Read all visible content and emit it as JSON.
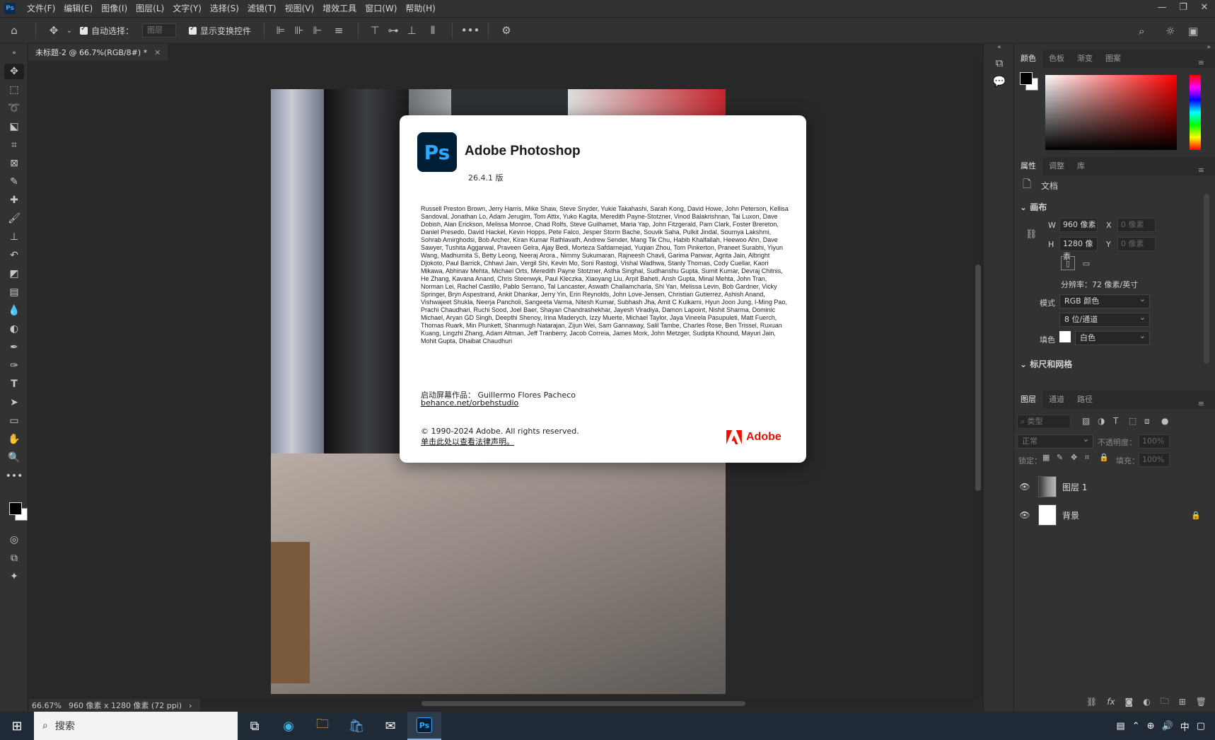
{
  "menubar": {
    "app_icon": "Ps",
    "items": [
      "文件(F)",
      "编辑(E)",
      "图像(I)",
      "图层(L)",
      "文字(Y)",
      "选择(S)",
      "滤镜(T)",
      "视图(V)",
      "增效工具",
      "窗口(W)",
      "帮助(H)"
    ],
    "window_controls": [
      "—",
      "❐",
      "✕"
    ]
  },
  "optionsbar": {
    "auto_select_label": "自动选择：",
    "auto_select_target": "图层",
    "show_transform_label": "显示变换控件"
  },
  "document": {
    "tab_title": "未标题-2 @ 66.7%(RGB/8#) *",
    "zoom": "66.67%",
    "doc_info": "960 像素 x 1280 像素 (72 ppi)"
  },
  "about": {
    "ps_badge": "Ps",
    "app_name": "Adobe Photoshop",
    "version": "26.4.1 版",
    "credits": "Russell Preston Brown, Jerry Harris, Mike Shaw, Steve Snyder, Yukie Takahashi, Sarah Kong, David Howe, John Peterson, Kellisa Sandoval, Jonathan Lo, Adam Jerugim, Tom Attix, Yuko Kagita, Meredith Payne-Stotzner, Vinod Balakrishnan, Tai Luxon, Dave Dobish, Alan Erickson, Melissa Monroe, Chad Rolfs, Steve Guilhamet, Maria Yap, John Fitzgerald, Pam Clark, Foster Brereton, Daniel Presedo, David Hackel, Kevin Hopps, Pete Falco, Jesper Storm Bache, Souvik Saha, Pulkit Jindal, Soumya Lakshmi, Sohrab Amirghodsi, Bob Archer, Kiran Kumar Rathlavath, Andrew Sender, Mang Tik Chu, Habib Khalfallah, Heewoo Ahn, Dave Sawyer, Tushita Aggarwal, Praveen Gelra, Ajay Bedi, Morteza Safdarnejad, Yuqian Zhou, Tom Pinkerton, Praneet Surabhi, Yiyun Wang, Madhumita S, Betty Leong, Neeraj Arora., Nimmy Sukumaran, Rajneesh Chavli, Garima Panwar, Agrita Jain, Albright Djokoto, Paul Barrick, Chhavi Jain, Vergil Shi, Kevin Mo, Soni Rastogi, Vishal Wadhwa, Stanly Thomas, Cody Cuellar, Kaori Mikawa, Abhinav Mehta, Michael Orts, Meredith Payne Stotzner, Astha Singhal, Sudhanshu Gupta, Sumit Kumar, Devraj Chitnis, He Zhang, Kavana Anand, Chris Steenwyk, Paul Kleczka, Xiaoyang Liu, Arpit Baheti, Ansh Gupta, Minal Mehta, John Tran, Norman Lei, Rachel Castillo, Pablo Serrano, Tal Lancaster, Aswath Challamcharla, Shi Yan, Melissa Levin, Bob Gardner, Vicky Springer, Bryn Aspestrand, Ankit Dhankar, Jerry Yin, Erin Reynolds, John Love-Jensen, Christian Gutierrez, Ashish Anand, Vishwajeet Shukla, Neerja Pancholi, Sangeeta Varma, Nitesh Kumar, Subhash Jha, Amit C Kulkarni, Hyun Joon Jung, I-Ming Pao, Prachi Chaudhari, Ruchi Sood, Joel Baer, Shayan Chandrashekhar, Jayesh Viradiya, Damon Lapoint, Nishit Sharma, Dominic Michael, Aryan GD Singh, Deepthi Shenoy, Irina Maderych, Izzy Muerte, Michael Taylor, Jaya Vineela Pasupuleti, Matt Fuerch, Thomas Ruark, Min Plunkett, Shanmugh Natarajan, Zijun Wei, Sam Gannaway, Salil Tambe, Charles Rose, Ben Trissel, Ruxuan Kuang, Lingzhi Zhang, Adam Altman, Jeff Tranberry, Jacob Correia, James Mork, John Metzger, Sudipta Khound, Mayuri Jain, Mohit Gupta, Dhaibat Chaudhuri",
    "splash_label": "启动屏幕作品：",
    "splash_artist": "Guillermo Flores Pacheco",
    "splash_link": "behance.net/orbehstudio",
    "copyright": "© 1990-2024 Adobe. All rights reserved.",
    "legal_link": "单击此处以查看法律声明。",
    "adobe_logo_text": "Adobe"
  },
  "panels": {
    "color_tabs": [
      "颜色",
      "色板",
      "渐变",
      "图案"
    ],
    "props_tabs": [
      "属性",
      "调整",
      "库"
    ],
    "doc_label": "文档",
    "canvas_section": "画布",
    "w_label": "W",
    "w_value": "960 像素",
    "h_label": "H",
    "h_value": "1280 像素",
    "x_label": "X",
    "x_placeholder": "0 像素",
    "y_label": "Y",
    "y_placeholder": "0 像素",
    "resolution": "分辨率：72 像素/英寸",
    "mode_label": "模式",
    "mode_value": "RGB 颜色",
    "depth_value": "8 位/通道",
    "fill_label": "填色",
    "fill_value": "白色",
    "rulers_section": "标尺和网格",
    "layers_tabs": [
      "图层",
      "通道",
      "路径"
    ],
    "filter_placeholder": "类型",
    "blend_mode": "正常",
    "opacity_label": "不透明度：",
    "opacity_value": "100%",
    "lock_label": "锁定：",
    "fill_opacity_label": "填充：",
    "fill_opacity_value": "100%",
    "layers": [
      {
        "name": "图层 1"
      },
      {
        "name": "背景"
      }
    ]
  },
  "taskbar": {
    "search_placeholder": "搜索",
    "tray_ime": "中"
  },
  "colors": {
    "ps_blue": "#31a8ff",
    "adobe_red": "#eb1000",
    "ui_bg": "#323232"
  }
}
